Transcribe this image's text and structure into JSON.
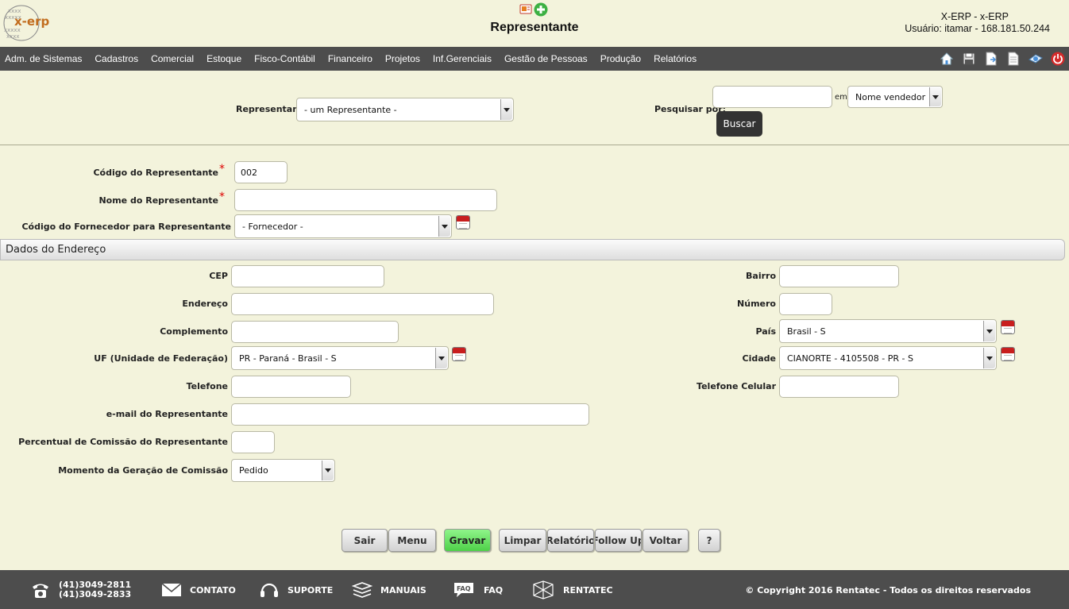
{
  "header": {
    "logo_text": "x-erp",
    "title": "Representante",
    "system": "X-ERP - x-ERP",
    "user": "Usuário: itamar - 168.181.50.244"
  },
  "nav": {
    "items": [
      "Adm. de Sistemas",
      "Cadastros",
      "Comercial",
      "Estoque",
      "Fisco-Contábil",
      "Financeiro",
      "Projetos",
      "Inf.Gerenciais",
      "Gestão de Pessoas",
      "Produção",
      "Relatórios"
    ],
    "icons": [
      "home-icon",
      "save-icon",
      "export-icon",
      "document-icon",
      "print-icon",
      "power-icon"
    ]
  },
  "search": {
    "representante_label": "Representante",
    "representante_value": "- um Representante -",
    "pesquisar_label": "Pesquisar por:",
    "pesquisar_value": "",
    "em_label": "em",
    "field_value": "Nome vendedor",
    "buscar_label": "Buscar"
  },
  "form": {
    "codigo_label": "Código do Representante",
    "codigo_value": "002",
    "nome_label": "Nome do Representante",
    "nome_value": "",
    "fornecedor_label": "Código do Fornecedor para Representante",
    "fornecedor_value": "- Fornecedor -",
    "required_mark": "*"
  },
  "address": {
    "section_title": "Dados do Endereço",
    "cep_label": "CEP",
    "cep_value": "",
    "endereco_label": "Endereço",
    "endereco_value": "",
    "complemento_label": "Complemento",
    "complemento_value": "",
    "uf_label": "UF (Unidade de Federação)",
    "uf_value": "PR - Paraná - Brasil - S",
    "telefone_label": "Telefone",
    "telefone_value": "",
    "email_label": "e-mail do Representante",
    "email_value": "",
    "percentual_label": "Percentual de Comissão do Representante",
    "percentual_value": "",
    "momento_label": "Momento da Geração de Comissão",
    "momento_value": "Pedido",
    "bairro_label": "Bairro",
    "bairro_value": "",
    "numero_label": "Número",
    "numero_value": "",
    "pais_label": "País",
    "pais_value": "Brasil - S",
    "cidade_label": "Cidade",
    "cidade_value": "CIANORTE - 4105508 - PR - S",
    "celular_label": "Telefone Celular",
    "celular_value": ""
  },
  "buttons": {
    "sair": "Sair",
    "menu": "Menu",
    "gravar": "Gravar",
    "limpar": "Limpar",
    "relatorio": "Relatório",
    "follow_up": "Follow Up",
    "voltar": "Voltar",
    "help": "?"
  },
  "footer": {
    "phone1": "(41)3049-2811",
    "phone2": "(41)3049-2833",
    "contato": "CONTATO",
    "suporte": "SUPORTE",
    "manuais": "MANUAIS",
    "faq": "FAQ",
    "faq_icon_text": "FAQ",
    "rentatec": "RENTATEC",
    "copyright": "© Copyright 2016 Rentatec - Todos os direitos reservados"
  },
  "colors": {
    "background": "#f3f3dc",
    "bar": "#4d4d4d",
    "gravar": "#5ad354",
    "required": "#dd0000"
  }
}
